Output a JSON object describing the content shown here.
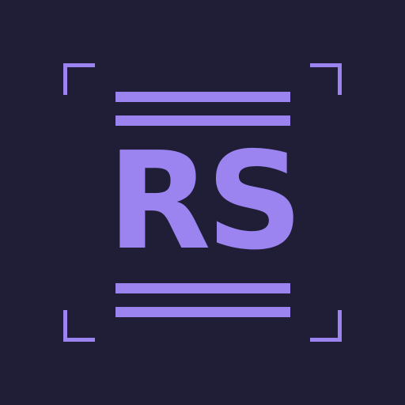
{
  "logo": {
    "monogram": "RS",
    "colors": {
      "background": "#201e37",
      "accent": "#9b84f0"
    },
    "decorations": {
      "corner_brackets": 4,
      "horizontal_rules_above": 2,
      "horizontal_rules_below": 2
    }
  }
}
